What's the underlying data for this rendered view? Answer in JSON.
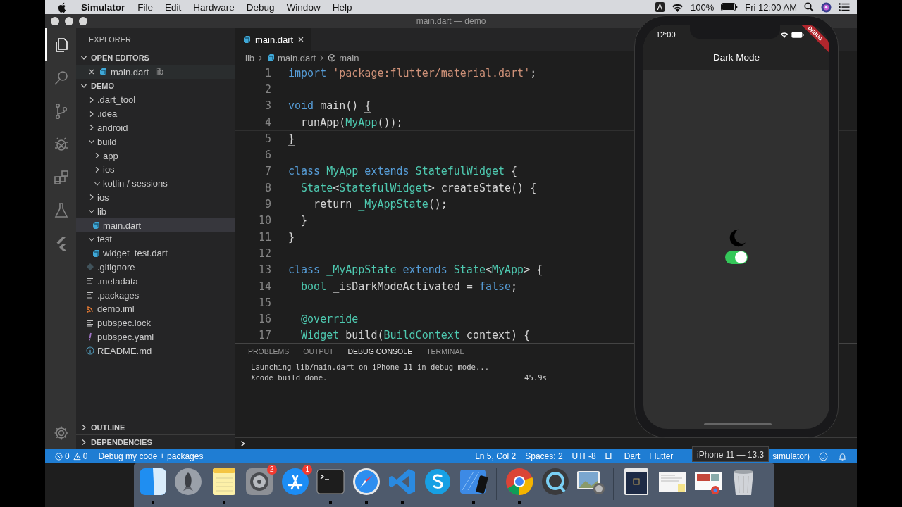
{
  "menubar": {
    "app": "Simulator",
    "menus": [
      "File",
      "Edit",
      "Hardware",
      "Debug",
      "Window",
      "Help"
    ],
    "input_source": "A",
    "battery": "100%",
    "clock": "Fri 12:00 AM"
  },
  "window": {
    "title": "main.dart — demo"
  },
  "activity_bar": [
    {
      "kind": "files",
      "selected": true
    },
    {
      "kind": "search",
      "selected": false
    },
    {
      "kind": "source-control",
      "selected": false
    },
    {
      "kind": "debug",
      "selected": false
    },
    {
      "kind": "extensions",
      "selected": false
    },
    {
      "kind": "test",
      "selected": false
    },
    {
      "kind": "flutter",
      "selected": false
    }
  ],
  "sidebar": {
    "title": "EXPLORER",
    "open_editors": {
      "label": "OPEN EDITORS",
      "expanded": true,
      "items": [
        {
          "name": "main.dart",
          "folder": "lib",
          "selected": true
        }
      ]
    },
    "project": {
      "label": "DEMO",
      "expanded": true,
      "tree": [
        {
          "name": ".dart_tool",
          "kind": "folder",
          "expanded": false,
          "selected": false
        },
        {
          "name": ".idea",
          "kind": "folder",
          "expanded": false,
          "selected": false
        },
        {
          "name": "android",
          "kind": "folder",
          "expanded": false,
          "selected": false
        },
        {
          "name": "build",
          "kind": "folder",
          "expanded": true,
          "selected": false,
          "children": [
            {
              "name": "app",
              "kind": "folder",
              "expanded": false,
              "selected": false
            },
            {
              "name": "ios",
              "kind": "folder",
              "expanded": false,
              "selected": false
            },
            {
              "name": "kotlin / sessions",
              "kind": "folder",
              "expanded": true,
              "selected": false
            }
          ]
        },
        {
          "name": "ios",
          "kind": "folder",
          "expanded": false,
          "selected": false
        },
        {
          "name": "lib",
          "kind": "folder",
          "expanded": true,
          "selected": false,
          "children": [
            {
              "name": "main.dart",
              "kind": "dart",
              "selected": true
            }
          ]
        },
        {
          "name": "test",
          "kind": "folder",
          "expanded": true,
          "selected": false,
          "children": [
            {
              "name": "widget_test.dart",
              "kind": "dart",
              "selected": false
            }
          ]
        },
        {
          "name": ".gitignore",
          "kind": "git",
          "selected": false
        },
        {
          "name": ".metadata",
          "kind": "text",
          "selected": false
        },
        {
          "name": ".packages",
          "kind": "text",
          "selected": false
        },
        {
          "name": "demo.iml",
          "kind": "feed",
          "selected": false
        },
        {
          "name": "pubspec.lock",
          "kind": "text",
          "selected": false
        },
        {
          "name": "pubspec.yaml",
          "kind": "yaml",
          "selected": false
        },
        {
          "name": "README.md",
          "kind": "info",
          "selected": false
        }
      ]
    },
    "bottom_sections": [
      {
        "label": "OUTLINE",
        "expanded": false
      },
      {
        "label": "DEPENDENCIES",
        "expanded": false
      }
    ]
  },
  "editor": {
    "tabs": [
      {
        "label": "main.dart",
        "selected": true
      }
    ],
    "breadcrumbs": [
      {
        "label": "lib",
        "kind": "folder"
      },
      {
        "label": "main.dart",
        "kind": "dart"
      },
      {
        "label": "main",
        "kind": "symbol"
      }
    ],
    "lines": [
      {
        "number": "1",
        "current": false,
        "tokens": [
          {
            "text": "import",
            "kind": "keyword"
          },
          {
            "text": " 'package:flutter/material.dart'",
            "kind": "string"
          },
          {
            "text": ";",
            "kind": "plain"
          }
        ]
      },
      {
        "number": "2",
        "current": false
      },
      {
        "number": "3",
        "current": false,
        "tokens": [
          {
            "text": "void",
            "kind": "keyword"
          },
          {
            "text": " main() ",
            "kind": "plain"
          },
          {
            "text": "{",
            "kind": "bracket"
          }
        ]
      },
      {
        "number": "4",
        "current": false,
        "tokens": [
          {
            "text": "  runApp(",
            "kind": "plain"
          },
          {
            "text": "MyApp",
            "kind": "type"
          },
          {
            "text": "());",
            "kind": "plain"
          }
        ]
      },
      {
        "number": "5",
        "current": true,
        "tokens": [
          {
            "text": "}",
            "kind": "bracket"
          }
        ]
      },
      {
        "number": "6",
        "current": false
      },
      {
        "number": "7",
        "current": false,
        "tokens": [
          {
            "text": "class",
            "kind": "keyword"
          },
          {
            "text": " MyApp",
            "kind": "type"
          },
          {
            "text": " extends",
            "kind": "keyword"
          },
          {
            "text": " StatefulWidget",
            "kind": "type"
          },
          {
            "text": " {",
            "kind": "plain"
          }
        ]
      },
      {
        "number": "8",
        "current": false,
        "tokens": [
          {
            "text": "  State",
            "kind": "type"
          },
          {
            "text": "<",
            "kind": "plain"
          },
          {
            "text": "StatefulWidget",
            "kind": "type"
          },
          {
            "text": "> createState() {",
            "kind": "plain"
          }
        ]
      },
      {
        "number": "9",
        "current": false,
        "tokens": [
          {
            "text": "    return ",
            "kind": "plain"
          },
          {
            "text": "_MyAppState",
            "kind": "type"
          },
          {
            "text": "();",
            "kind": "plain"
          }
        ]
      },
      {
        "number": "10",
        "current": false,
        "tokens": [
          {
            "text": "  }",
            "kind": "plain"
          }
        ]
      },
      {
        "number": "11",
        "current": false,
        "tokens": [
          {
            "text": "}",
            "kind": "plain"
          }
        ]
      },
      {
        "number": "12",
        "current": false
      },
      {
        "number": "13",
        "current": false,
        "tokens": [
          {
            "text": "class",
            "kind": "keyword"
          },
          {
            "text": " _MyAppState",
            "kind": "type"
          },
          {
            "text": " extends",
            "kind": "keyword"
          },
          {
            "text": " State",
            "kind": "type"
          },
          {
            "text": "<",
            "kind": "plain"
          },
          {
            "text": "MyApp",
            "kind": "type"
          },
          {
            "text": "> {",
            "kind": "plain"
          }
        ]
      },
      {
        "number": "14",
        "current": false,
        "tokens": [
          {
            "text": "  bool",
            "kind": "type"
          },
          {
            "text": " _isDarkModeActivated = ",
            "kind": "plain"
          },
          {
            "text": "false",
            "kind": "keyword"
          },
          {
            "text": ";",
            "kind": "plain"
          }
        ]
      },
      {
        "number": "15",
        "current": false
      },
      {
        "number": "16",
        "current": false,
        "tokens": [
          {
            "text": "  @override",
            "kind": "type"
          }
        ]
      },
      {
        "number": "17",
        "current": false,
        "tokens": [
          {
            "text": "  Widget",
            "kind": "type"
          },
          {
            "text": " build(",
            "kind": "plain"
          },
          {
            "text": "BuildContext",
            "kind": "type"
          },
          {
            "text": " context) {",
            "kind": "plain"
          }
        ]
      }
    ]
  },
  "panel": {
    "tabs": [
      {
        "label": "PROBLEMS",
        "selected": false
      },
      {
        "label": "OUTPUT",
        "selected": false
      },
      {
        "label": "DEBUG CONSOLE",
        "selected": true
      },
      {
        "label": "TERMINAL",
        "selected": false
      }
    ],
    "console": [
      {
        "text": "Launching lib/main.dart on iPhone 11 in debug mode..."
      },
      {
        "text": "Xcode build done.",
        "time": "45.9s"
      }
    ]
  },
  "status_bar": {
    "errors": "0",
    "warnings": "0",
    "launch": "Debug my code + packages",
    "items": [
      "Ln 5, Col 2",
      "Spaces: 2",
      "UTF-8",
      "LF",
      "Dart",
      "Flutter"
    ],
    "items_after": [
      "simulator)"
    ]
  },
  "tooltip": "iPhone 11 — 13.3",
  "simulator": {
    "time": "12:00",
    "debug_banner": "DEBUG",
    "app_title": "Dark Mode",
    "dark_mode_switch": {
      "on": true
    }
  },
  "dock": [
    {
      "kind": "finder",
      "running": true
    },
    {
      "kind": "launchpad",
      "running": false
    },
    {
      "kind": "notes",
      "running": true
    },
    {
      "kind": "preferences",
      "badge": "2",
      "running": false
    },
    {
      "kind": "appstore",
      "badge": "1",
      "running": false
    },
    {
      "kind": "terminal",
      "running": true
    },
    {
      "kind": "safari",
      "running": true
    },
    {
      "kind": "vscode",
      "running": true
    },
    {
      "kind": "skype",
      "running": false
    },
    {
      "kind": "simulator",
      "running": true
    },
    {
      "kind": "separator"
    },
    {
      "kind": "chrome",
      "running": true
    },
    {
      "kind": "quicktime",
      "running": false
    },
    {
      "kind": "preview",
      "running": false
    },
    {
      "kind": "separator"
    },
    {
      "kind": "folder",
      "running": false
    },
    {
      "kind": "document",
      "running": false
    },
    {
      "kind": "screenshot",
      "running": false
    },
    {
      "kind": "trash",
      "running": false
    }
  ]
}
